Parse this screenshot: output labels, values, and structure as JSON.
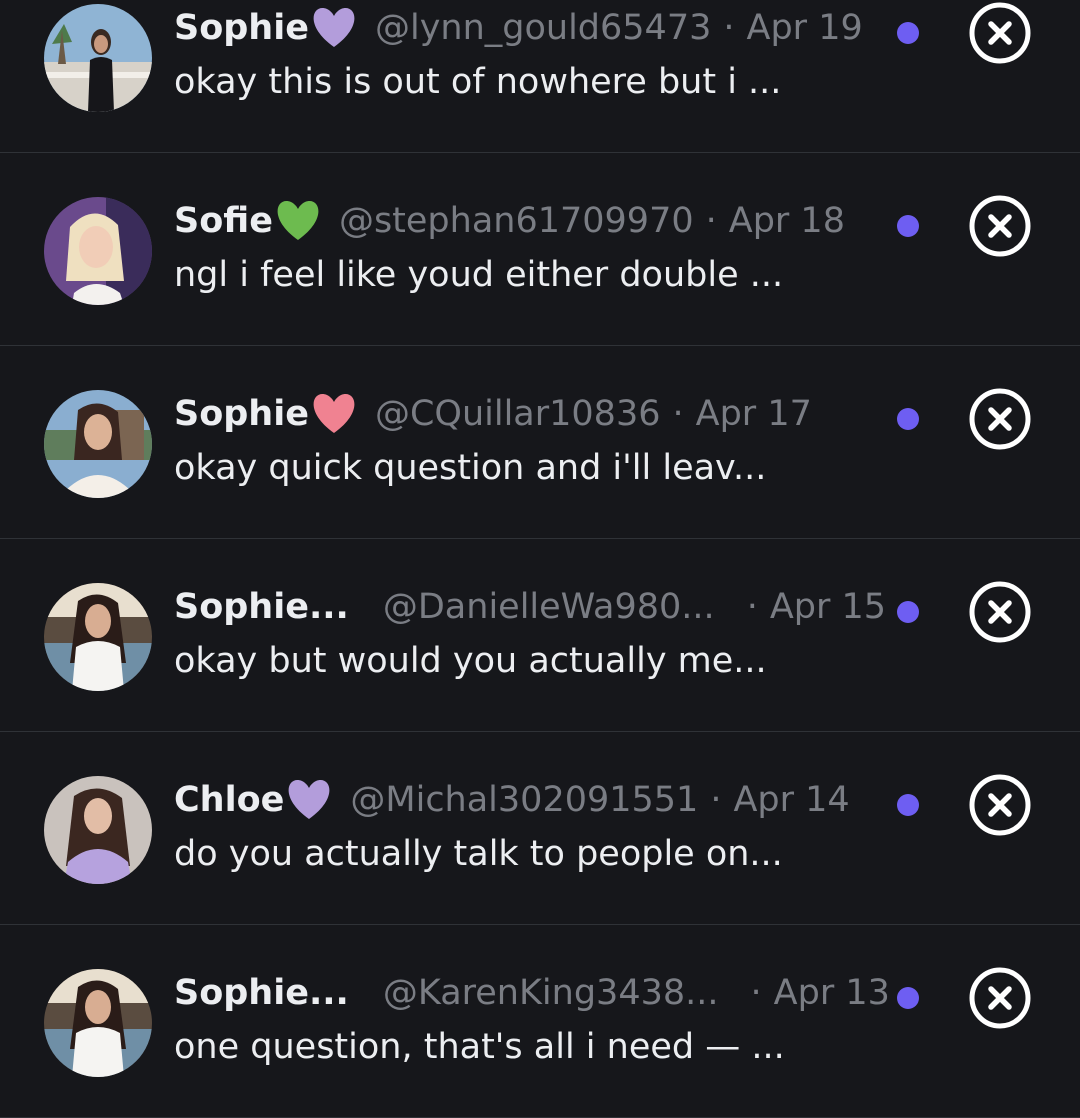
{
  "colors": {
    "background": "#16171b",
    "divider": "#2f3237",
    "unread_dot": "#6e5ef2",
    "heart_purple": "#b39ddb",
    "heart_green": "#6dbb4f",
    "heart_pink": "#f08291"
  },
  "conversations": [
    {
      "name": "Sophie",
      "badge": "purple-heart-icon",
      "handle": "@lynn_gould65473",
      "separator": "·",
      "date": "Apr 19",
      "preview": "okay this is out of nowhere but i ...",
      "unread": true
    },
    {
      "name": "Sofie",
      "badge": "green-heart-icon",
      "handle": "@stephan61709970",
      "separator": "·",
      "date": "Apr 18",
      "preview": "ngl i feel like youd either double ...",
      "unread": true
    },
    {
      "name": "Sophie",
      "badge": "pink-heart-icon",
      "handle": "@CQuillar10836",
      "separator": "·",
      "date": "Apr 17",
      "preview": "okay quick question and i'll leav...",
      "unread": true
    },
    {
      "name": "Sophie...",
      "badge": "",
      "handle": "@DanielleWa980...",
      "separator": "·",
      "date": "Apr 15",
      "preview": "okay but would you actually me...",
      "unread": true
    },
    {
      "name": "Chloe",
      "badge": "purple-heart-icon",
      "handle": "@Michal302091551",
      "separator": "·",
      "date": "Apr 14",
      "preview": "do you actually talk to people on...",
      "unread": true
    },
    {
      "name": "Sophie...",
      "badge": "",
      "handle": "@KarenKing3438...",
      "separator": "·",
      "date": "Apr 13",
      "preview": "one question, that's all i need — ...",
      "unread": true
    }
  ]
}
